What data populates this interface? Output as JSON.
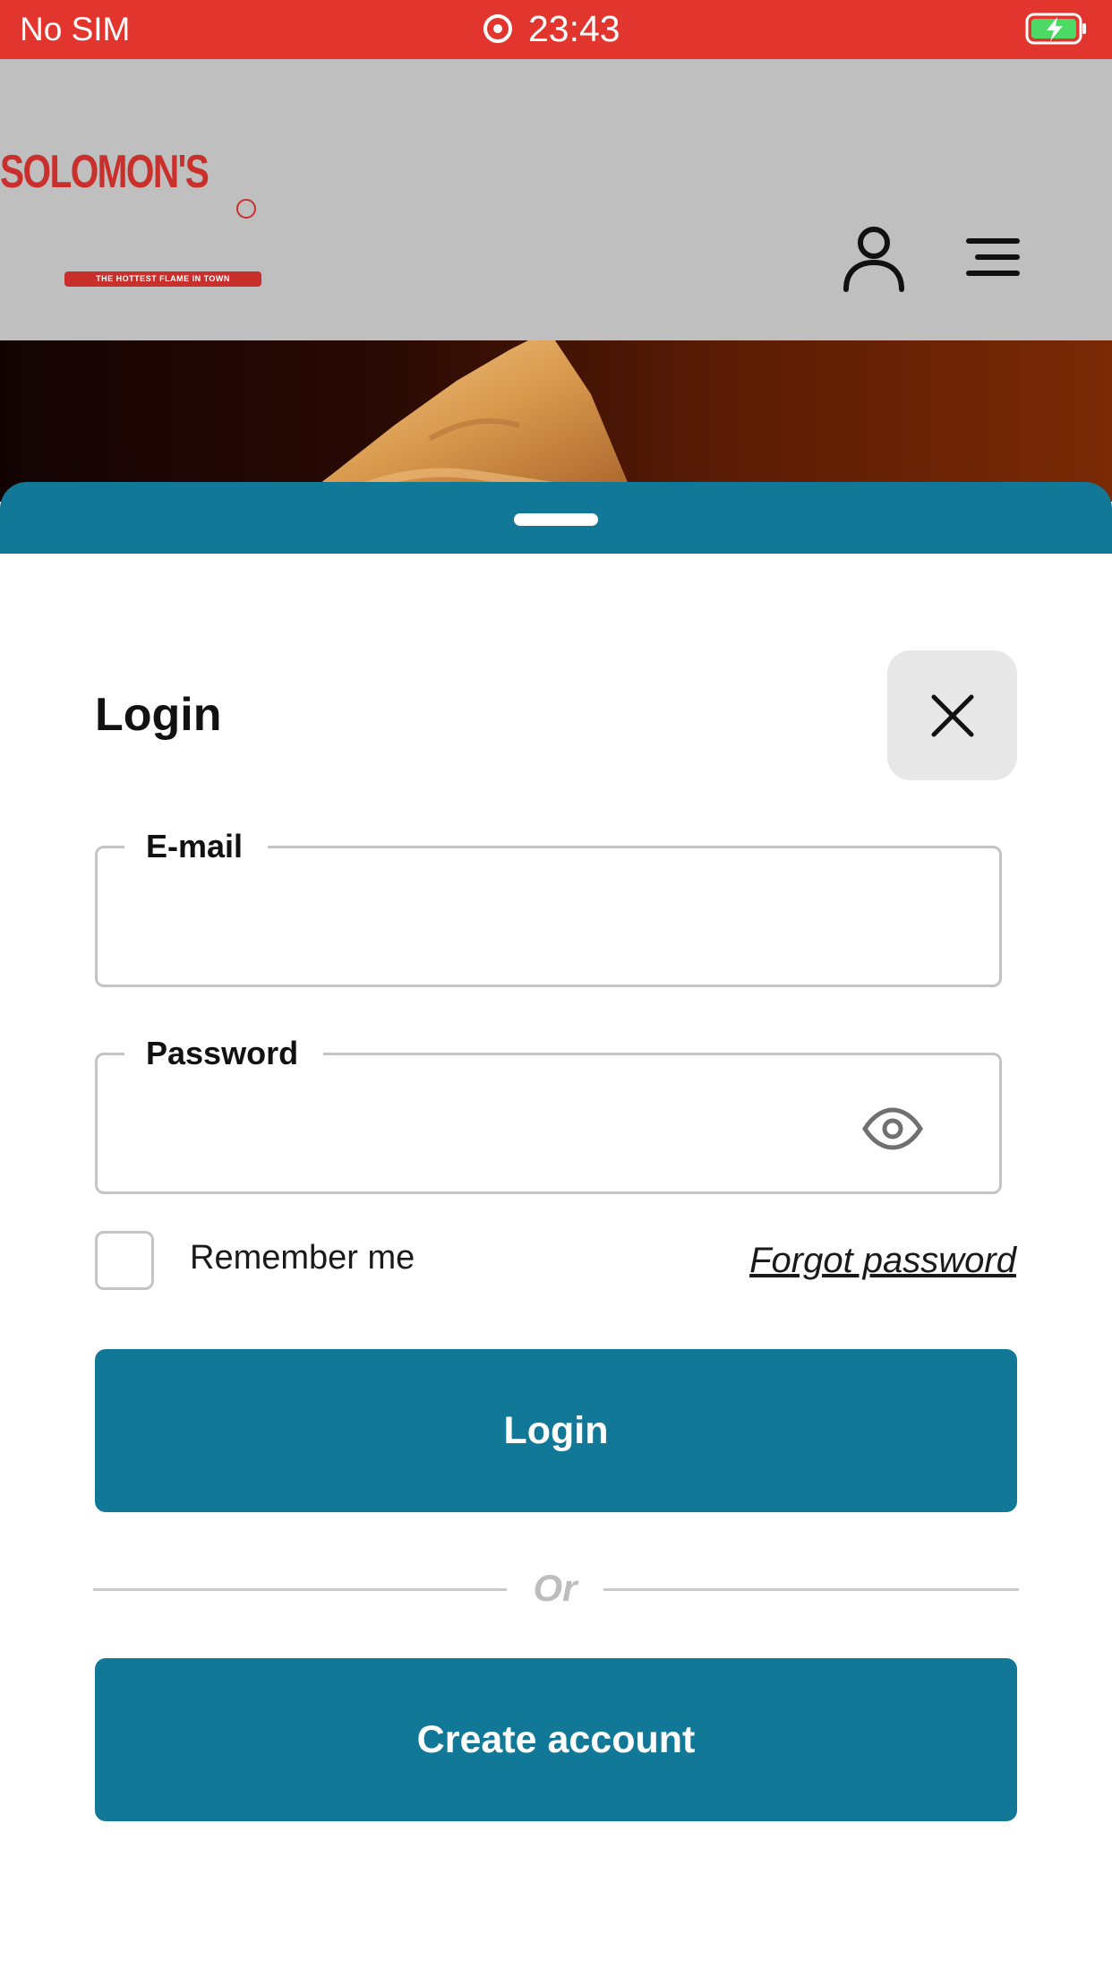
{
  "status_bar": {
    "carrier": "No SIM",
    "time": "23:43",
    "bar_color": "#e2352d",
    "battery_fill_color": "#4cd964"
  },
  "header": {
    "logo": {
      "brand": "SOLOMON'S",
      "tagline": "THE HOTTEST FLAME IN TOWN",
      "color": "#c9302c"
    },
    "icons": [
      "user-icon",
      "menu-icon"
    ],
    "background": "#bfbfbf"
  },
  "sheet": {
    "accent_color": "#127898",
    "title": "Login",
    "email": {
      "label": "E-mail",
      "value": ""
    },
    "password": {
      "label": "Password",
      "value": ""
    },
    "remember_me": {
      "label": "Remember me",
      "checked": false
    },
    "forgot_password": "Forgot password",
    "login_button": "Login",
    "divider": "Or",
    "create_account_button": "Create account"
  }
}
